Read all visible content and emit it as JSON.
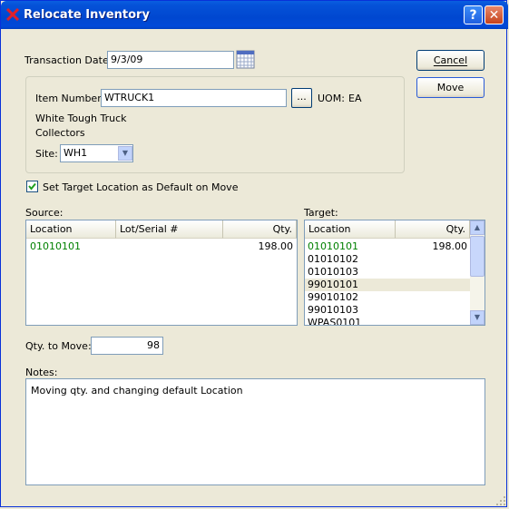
{
  "window": {
    "title": "Relocate Inventory",
    "help_label": "?",
    "close_label": "✕",
    "title_bar_color": "#0054e3"
  },
  "form": {
    "transaction_date_label": "Transaction Date:",
    "transaction_date_value": "9/3/09",
    "item_number_label": "Item Number:",
    "item_number_value": "WTRUCK1",
    "lookup_label": "...",
    "uom_label": "UOM:",
    "uom_value": "EA",
    "description_1": "White Tough Truck",
    "description_2": "Collectors",
    "site_label": "Site:",
    "site_value": "WH1",
    "default_checkbox_label": "Set Target Location as Default on Move",
    "default_checkbox_checked": true,
    "qty_label": "Qty. to Move:",
    "qty_value": "98",
    "notes_label": "Notes:",
    "notes_value": "Moving qty. and changing default Location"
  },
  "buttons": {
    "cancel": "Cancel",
    "move": "Move"
  },
  "source": {
    "label": "Source:",
    "columns": [
      "Location",
      "Lot/Serial #",
      "Qty."
    ],
    "rows": [
      {
        "location": "01010101",
        "lot": "",
        "qty": "198.00"
      }
    ]
  },
  "target": {
    "label": "Target:",
    "columns": [
      "Location",
      "Qty."
    ],
    "rows": [
      {
        "location": "01010101",
        "qty": "198.00"
      },
      {
        "location": "01010102",
        "qty": ""
      },
      {
        "location": "01010103",
        "qty": ""
      },
      {
        "location": "99010101",
        "qty": ""
      },
      {
        "location": "99010102",
        "qty": ""
      },
      {
        "location": "99010103",
        "qty": ""
      },
      {
        "location": "WPAS0101",
        "qty": ""
      }
    ]
  },
  "colors": {
    "accent_green": "#008000",
    "selected_row": "#ece9d8"
  }
}
